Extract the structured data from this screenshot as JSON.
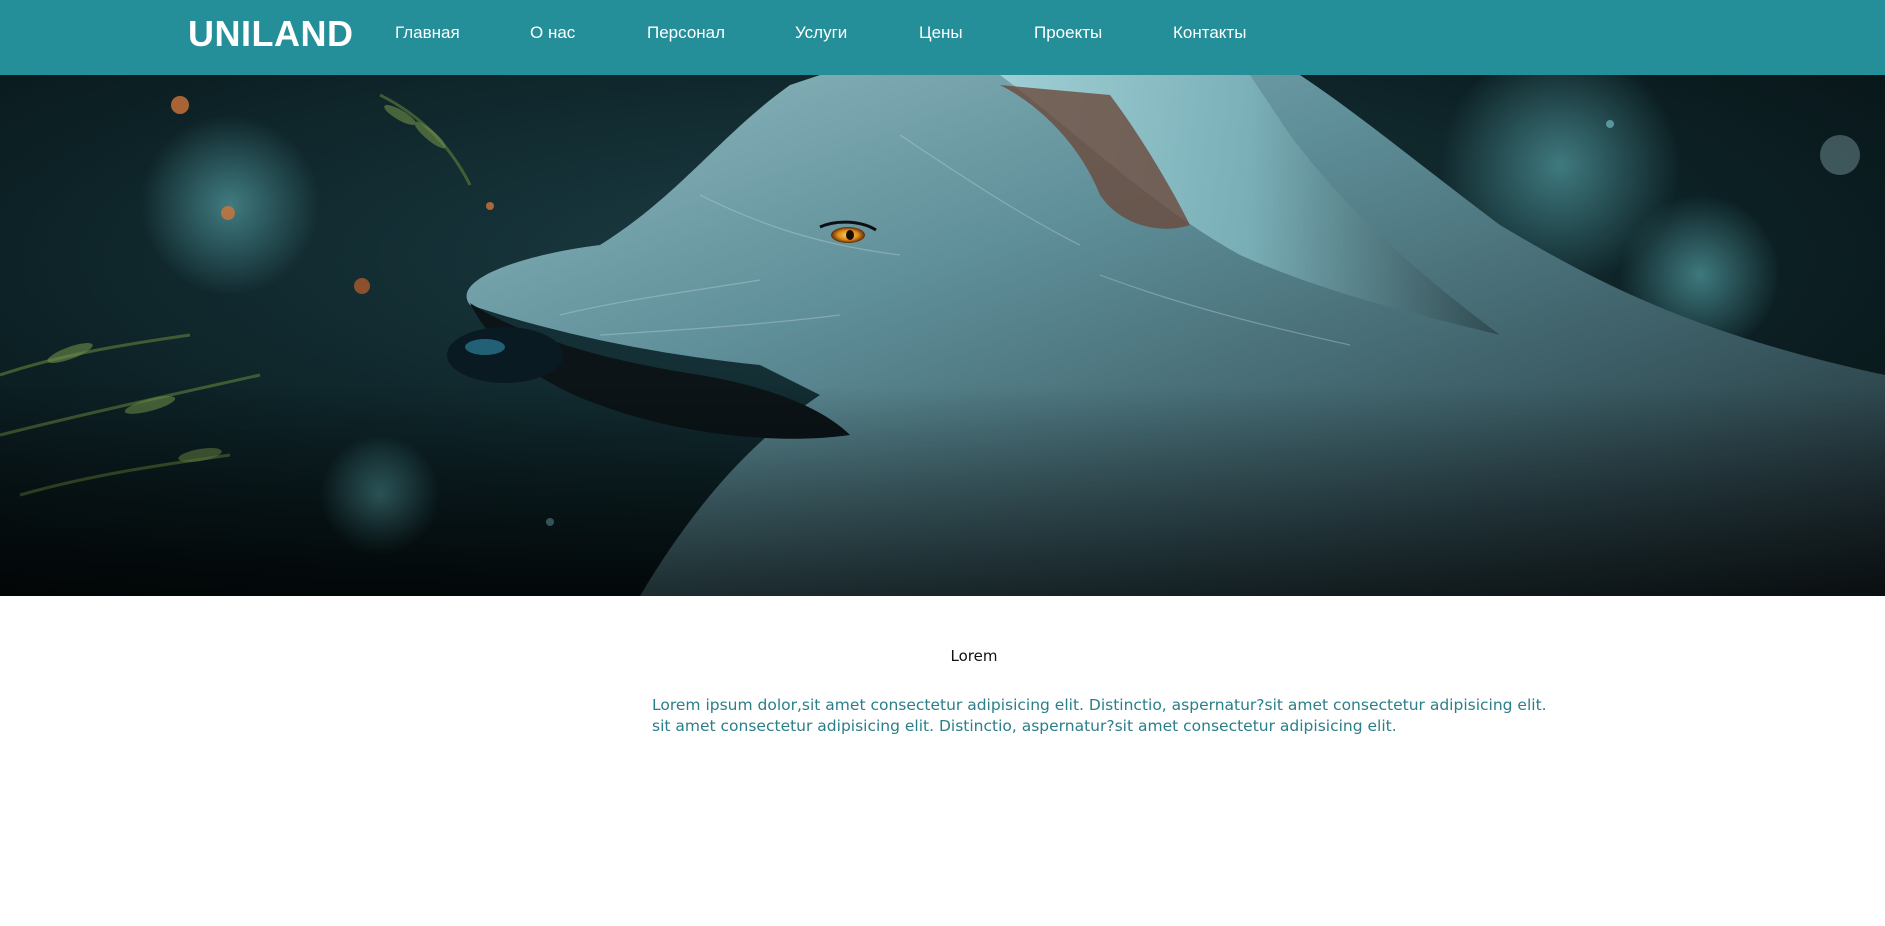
{
  "header": {
    "logo": "UNILAND",
    "nav": [
      {
        "label": "Главная"
      },
      {
        "label": "О нас"
      },
      {
        "label": "Персонал"
      },
      {
        "label": "Услуги"
      },
      {
        "label": "Цены"
      },
      {
        "label": "Проекты"
      },
      {
        "label": "Контакты"
      }
    ]
  },
  "hero": {
    "image": "wolf-portrait-image"
  },
  "content": {
    "title": "Lorem",
    "lines": [
      "Lorem ipsum dolor,sit amet consectetur adipisicing elit. Distinctio, aspernatur?sit amet consectetur adipisicing elit.",
      "sit amet consectetur adipisicing elit. Distinctio, aspernatur?sit amet consectetur adipisicing elit."
    ]
  },
  "colors": {
    "header_bg": "#248f99",
    "text_accent": "#2a7f89"
  }
}
